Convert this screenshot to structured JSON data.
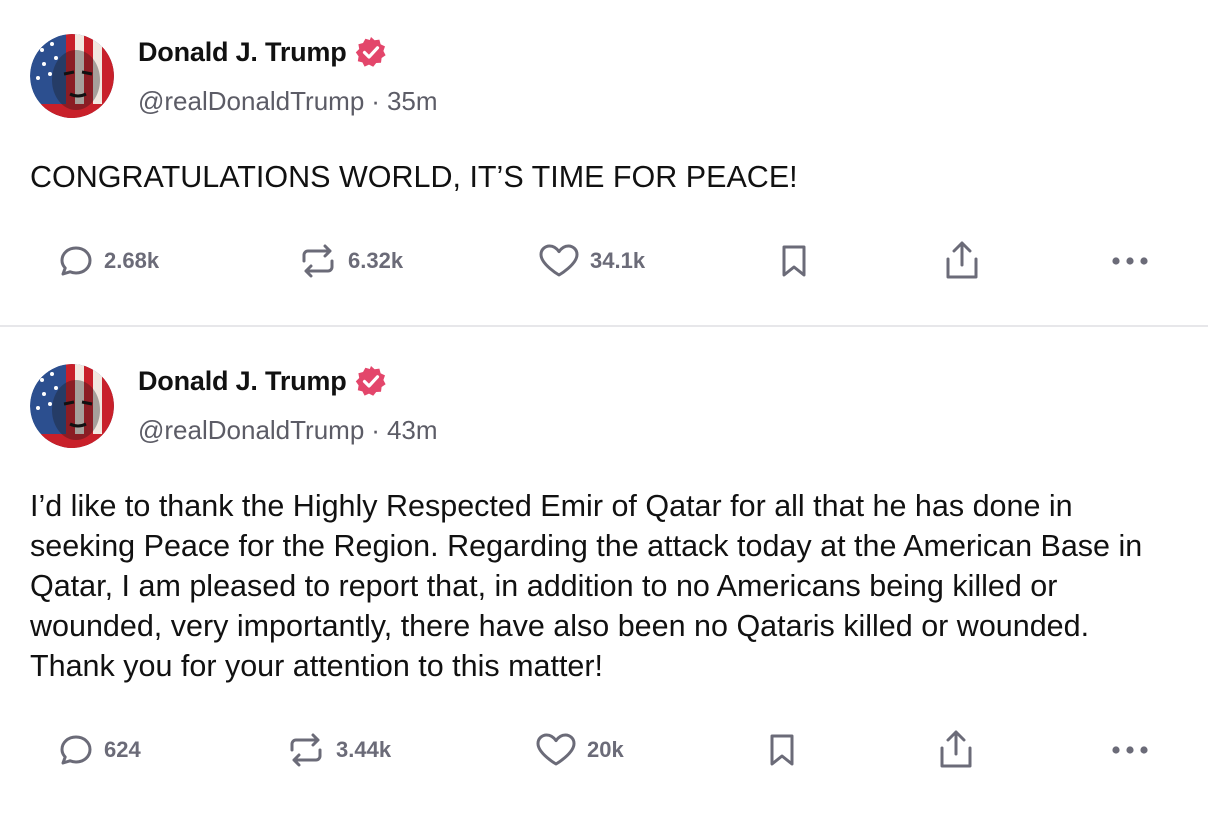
{
  "colors": {
    "badge": "#e3466b",
    "text": "#111111",
    "muted": "#5c5c66",
    "icon": "#6b6b78",
    "divider": "#e7e7ea"
  },
  "posts": [
    {
      "author": "Donald J. Trump",
      "handle": "@realDonaldTrump",
      "separator": "·",
      "time": "35m",
      "text": "CONGRATULATIONS WORLD, IT’S TIME FOR PEACE!",
      "stats": {
        "replies": "2.68k",
        "reposts": "6.32k",
        "likes": "34.1k"
      },
      "icons": [
        "reply-icon",
        "repost-icon",
        "heart-icon",
        "bookmark-icon",
        "share-icon",
        "more-icon"
      ]
    },
    {
      "author": "Donald J. Trump",
      "handle": "@realDonaldTrump",
      "separator": "·",
      "time": "43m",
      "text": "I’d like to thank the Highly Respected Emir of Qatar for all that he has done in seeking Peace for the Region. Regarding the attack today at the American Base in Qatar, I am pleased to report that, in addition to no Americans being killed or wounded, very importantly, there have also been no Qataris killed or wounded. Thank you for your attention to this matter!",
      "stats": {
        "replies": "624",
        "reposts": "3.44k",
        "likes": "20k"
      },
      "icons": [
        "reply-icon",
        "repost-icon",
        "heart-icon",
        "bookmark-icon",
        "share-icon",
        "more-icon"
      ]
    }
  ]
}
